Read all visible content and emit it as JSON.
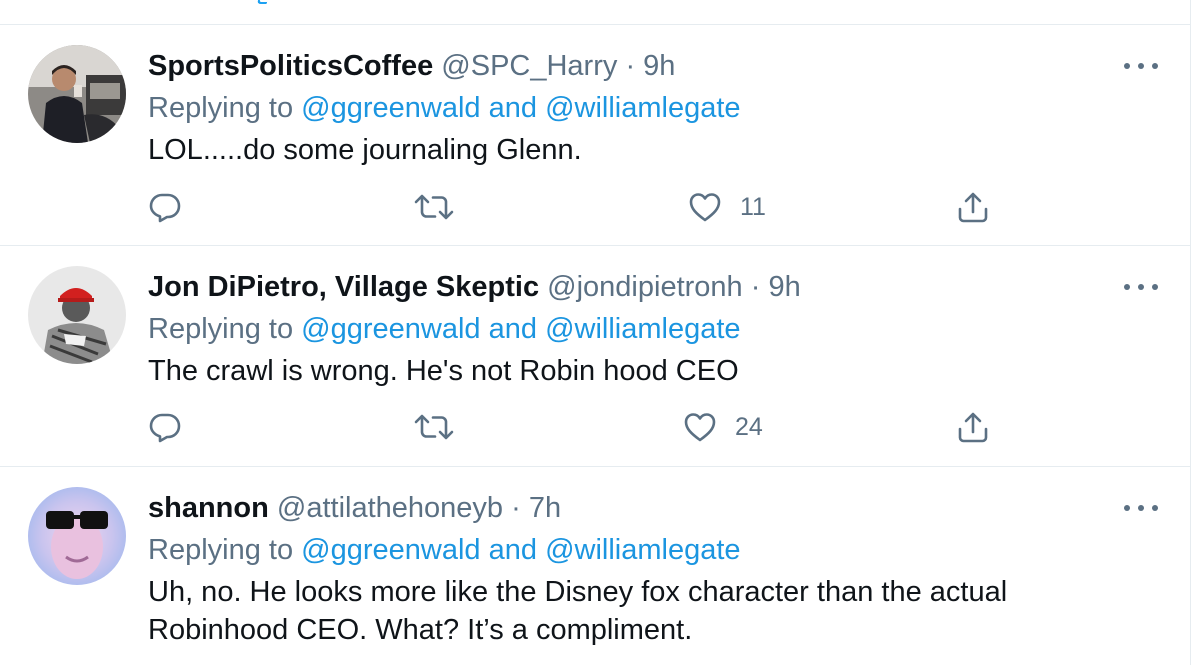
{
  "tweets": [
    {
      "name": "SportsPoliticsCoffee",
      "handle": "@SPC_Harry",
      "separator": "·",
      "time": "9h",
      "replying_prefix": "Replying to",
      "mention_1": "@ggreenwald",
      "and": "and",
      "mention_2": "@williamlegate",
      "text": "LOL.....do some journaling Glenn.",
      "likes": "11"
    },
    {
      "name": "Jon DiPietro, Village Skeptic",
      "handle": "@jondipietronh",
      "separator": "·",
      "time": "9h",
      "replying_prefix": "Replying to",
      "mention_1": "@ggreenwald",
      "and": "and",
      "mention_2": "@williamlegate",
      "text": "The crawl is wrong. He's not Robin hood CEO",
      "likes": "24"
    },
    {
      "name": "shannon",
      "handle": "@attilathehoneyb",
      "separator": "·",
      "time": "7h",
      "replying_prefix": "Replying to",
      "mention_1": "@ggreenwald",
      "and": "and",
      "mention_2": "@williamlegate",
      "text": "Uh, no. He looks more like the Disney fox character than the actual Robinhood CEO. What? It’s a compliment."
    }
  ],
  "icons": {
    "reply": "reply-icon",
    "retweet": "retweet-icon",
    "like": "heart-icon",
    "share": "share-icon",
    "more": "more-icon"
  },
  "colors": {
    "name": "#0f1419",
    "secondary": "#5b7083",
    "mention": "#1b95e0",
    "divider": "#e6ecf0"
  }
}
